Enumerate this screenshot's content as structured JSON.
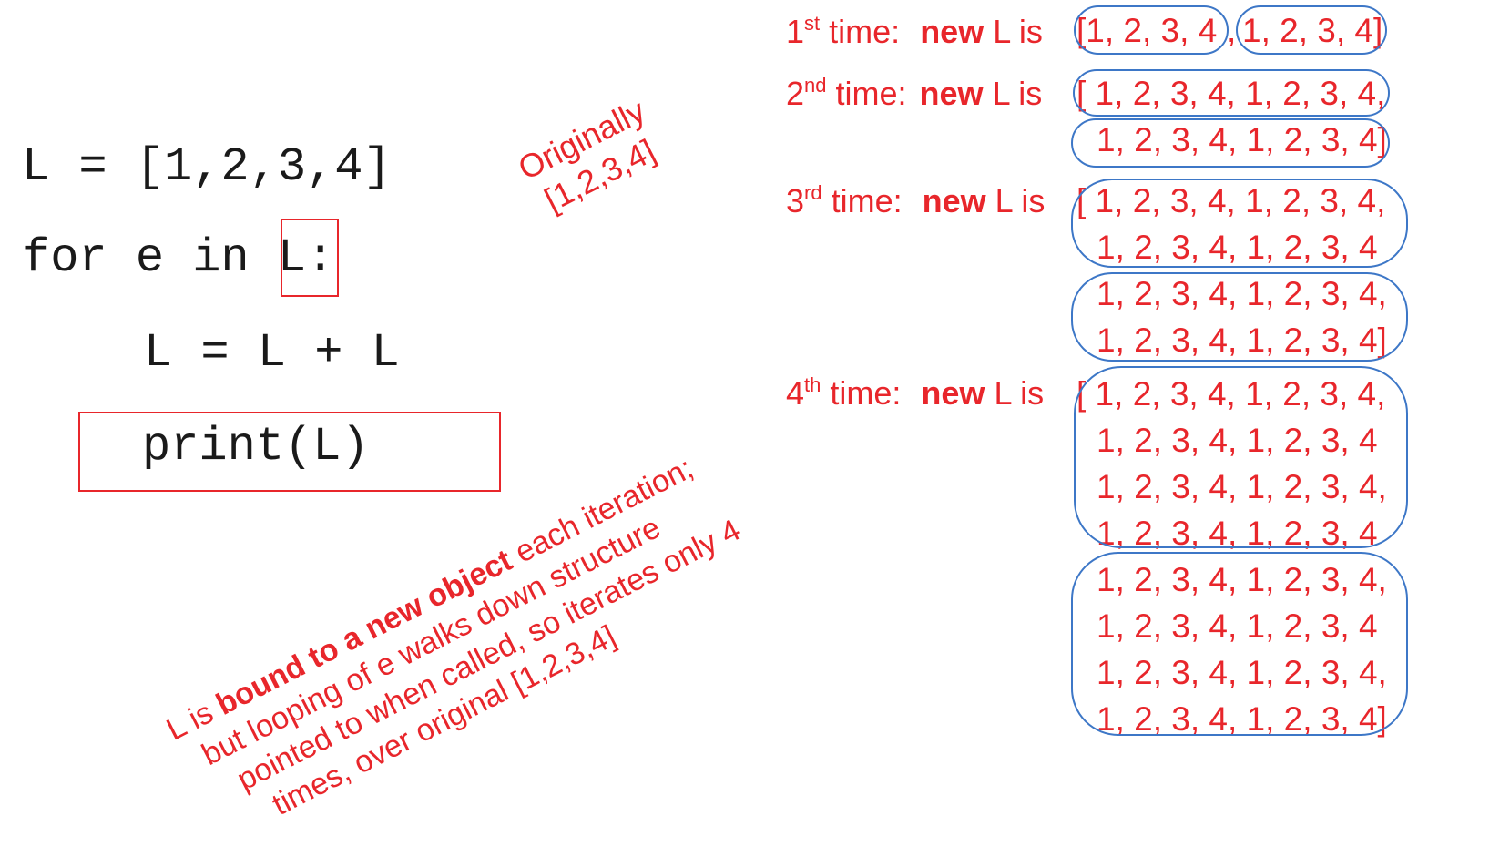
{
  "code": {
    "line1": "L = [1,2,3,4]",
    "line2_prefix": "for e in ",
    "line2_var": "L",
    "line2_suffix": ":",
    "line3": "L = L + L",
    "line4": "print(L)"
  },
  "notes": {
    "originally": "Originally\n[1,2,3,4]",
    "bound": {
      "line1_prefix": "L is ",
      "line1_bold": "bound to a new object",
      "line1_suffix": " each iteration;",
      "line2": "but looping of e walks down structure",
      "line3": "pointed to when called, so iterates only 4",
      "line4": "times, over original [1,2,3,4]"
    }
  },
  "iterations": [
    {
      "num": "1",
      "ordinal": "st",
      "time": "time:",
      "new": "new",
      "lis": "L is"
    },
    {
      "num": "2",
      "ordinal": "nd",
      "time": "time:",
      "new": "new",
      "lis": "L is"
    },
    {
      "num": "3",
      "ordinal": "rd",
      "time": "time:",
      "new": "new",
      "lis": "L is"
    },
    {
      "num": "4",
      "ordinal": "th",
      "time": "time:",
      "new": "new",
      "lis": "L is"
    }
  ],
  "lists": {
    "t1_a": "[1, 2, 3, 4",
    "t1_sep": ",",
    "t1_b": "1, 2, 3, 4]",
    "t2_l1": "[ 1, 2, 3, 4, 1, 2, 3, 4,",
    "t2_l2": "1, 2, 3, 4, 1, 2, 3, 4]",
    "t3_l1": "[ 1, 2, 3, 4, 1, 2, 3, 4,",
    "t3_l2": "1, 2, 3, 4, 1, 2, 3, 4",
    "t3_l3": "1, 2, 3, 4, 1, 2, 3, 4,",
    "t3_l4": "1, 2, 3, 4, 1, 2, 3, 4]",
    "t4_l1": "[ 1, 2, 3, 4, 1, 2, 3, 4,",
    "t4_l2": "1, 2, 3, 4, 1, 2, 3, 4",
    "t4_l3": "1, 2, 3, 4, 1, 2, 3, 4,",
    "t4_l4": "1, 2, 3, 4, 1, 2, 3, 4",
    "t4_l5": "1, 2, 3, 4, 1, 2, 3, 4,",
    "t4_l6": "1, 2, 3, 4, 1, 2, 3, 4",
    "t4_l7": "1, 2, 3, 4, 1, 2, 3, 4,",
    "t4_l8": "1, 2, 3, 4, 1, 2, 3, 4]"
  },
  "colors": {
    "annotation": "#e8262b",
    "group_outline": "#3d77c7",
    "code": "#1a1a1a"
  }
}
